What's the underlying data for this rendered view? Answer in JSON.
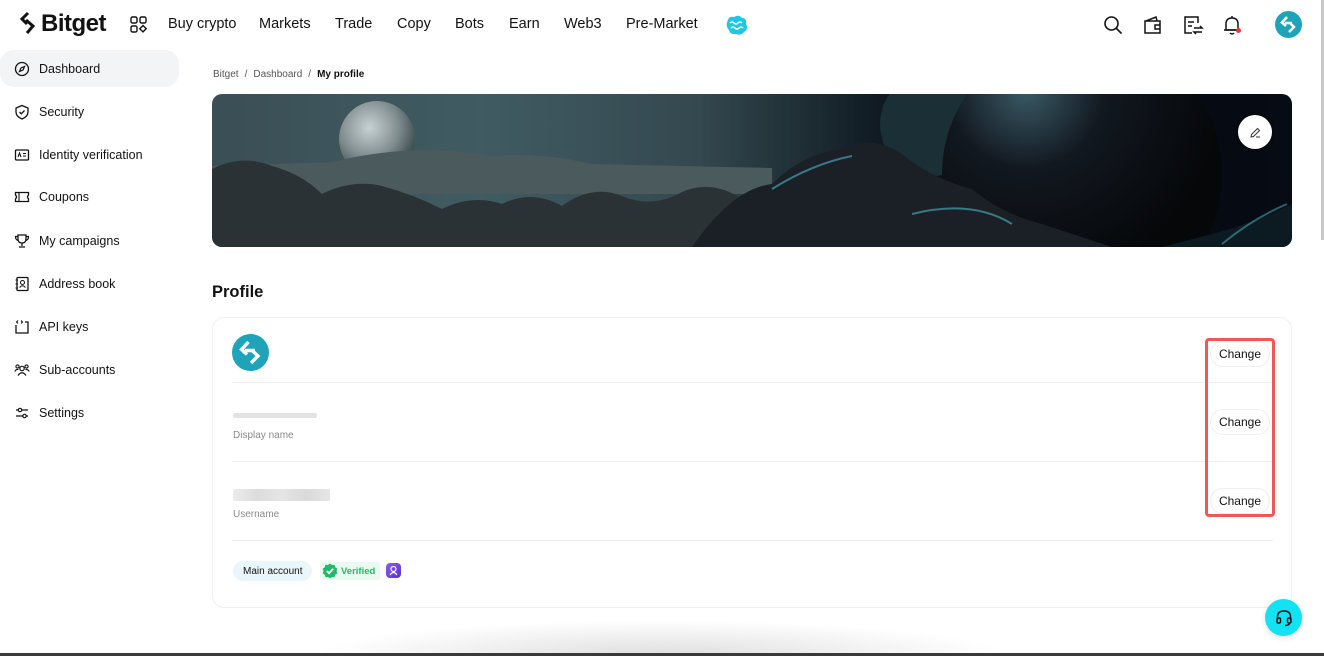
{
  "brand": {
    "name": "Bitget",
    "accent": "#12e2f2",
    "logo_color": "#121212"
  },
  "nav": {
    "items": [
      {
        "label": "Buy crypto"
      },
      {
        "label": "Markets"
      },
      {
        "label": "Trade"
      },
      {
        "label": "Copy"
      },
      {
        "label": "Bots"
      },
      {
        "label": "Earn"
      },
      {
        "label": "Web3"
      },
      {
        "label": "Pre-Market"
      }
    ],
    "icons": [
      "apps-grid-icon",
      "promo-icon",
      "search-icon",
      "wallet-icon",
      "orders-icon",
      "bell-icon",
      "user-avatar"
    ]
  },
  "sidebar": {
    "items": [
      {
        "label": "Dashboard",
        "icon": "compass-icon",
        "active": true
      },
      {
        "label": "Security",
        "icon": "shield-icon"
      },
      {
        "label": "Identity verification",
        "icon": "id-card-icon"
      },
      {
        "label": "Coupons",
        "icon": "ticket-icon"
      },
      {
        "label": "My campaigns",
        "icon": "trophy-icon"
      },
      {
        "label": "Address book",
        "icon": "address-book-icon"
      },
      {
        "label": "API keys",
        "icon": "code-icon"
      },
      {
        "label": "Sub-accounts",
        "icon": "users-icon"
      },
      {
        "label": "Settings",
        "icon": "sliders-icon"
      }
    ]
  },
  "breadcrumb": {
    "items": [
      "Bitget",
      "Dashboard",
      "My profile"
    ],
    "separator": "/"
  },
  "profile": {
    "title": "Profile",
    "fields": [
      {
        "label": "",
        "action": "Change"
      },
      {
        "label": "Display name",
        "value_hidden": true,
        "action": "Change"
      },
      {
        "label": "Username",
        "value_hidden": true,
        "action": "Change"
      }
    ],
    "badges": {
      "account_type": "Main account",
      "verified": "Verified",
      "verified_color": "#1fbb6a"
    }
  },
  "highlight_color": "#ec5a56"
}
